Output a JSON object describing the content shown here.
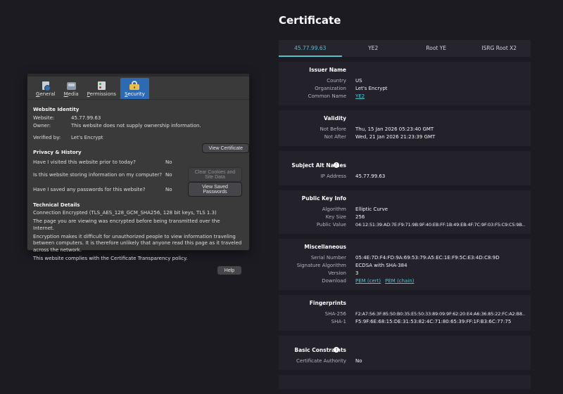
{
  "colors": {
    "page_background": "#1c1b22",
    "accent_teal": "#4ec1cd",
    "selected_tab_blue": "#2d6ab4",
    "padlock_yellow": "#e8c14a",
    "section_background": "#232129"
  },
  "page_info": {
    "tabs": [
      {
        "label": "General"
      },
      {
        "label": "Media"
      },
      {
        "label": "Permissions"
      },
      {
        "label": "Security"
      }
    ],
    "identity": {
      "heading": "Website Identity",
      "website_label": "Website:",
      "website_value": "45.77.99.63",
      "owner_label": "Owner:",
      "owner_value": "This website does not supply ownership information.",
      "verified_label": "Verified by:",
      "verified_value": "Let's Encrypt",
      "view_certificate": "View Certificate"
    },
    "privacy": {
      "heading": "Privacy & History",
      "rows": [
        {
          "question": "Have I visited this website prior to today?",
          "answer": "No"
        },
        {
          "question": "Is this website storing information on my computer?",
          "answer": "No",
          "button": "Clear Cookies and Site Data"
        },
        {
          "question": "Have I saved any passwords for this website?",
          "answer": "No",
          "button": "View Saved Passwords"
        }
      ]
    },
    "technical": {
      "heading": "Technical Details",
      "lines": [
        "Connection Encrypted (TLS_AES_128_GCM_SHA256, 128 bit keys, TLS 1.3)",
        "The page you are viewing was encrypted before being transmitted over the Internet.",
        "Encryption makes it difficult for unauthorized people to view information traveling between computers. It is therefore unlikely that anyone read this page as it traveled across the network.",
        "This website complies with the Certificate Transparency policy."
      ],
      "help": "Help"
    }
  },
  "certificate": {
    "title": "Certificate",
    "critical_icon": "!",
    "tabs": [
      {
        "label": "45.77.99.63"
      },
      {
        "label": "YE2"
      },
      {
        "label": "Root YE"
      },
      {
        "label": "ISRG Root X2"
      }
    ],
    "sections": [
      {
        "heading": "Issuer Name",
        "rows": [
          {
            "label": "Country",
            "value": "US"
          },
          {
            "label": "Organization",
            "value": "Let's Encrypt"
          },
          {
            "label": "Common Name",
            "link": "YE2"
          }
        ]
      },
      {
        "heading": "Validity",
        "rows": [
          {
            "label": "Not Before",
            "value": "Thu, 15 Jan 2026 05:23:40 GMT"
          },
          {
            "label": "Not After",
            "value": "Wed, 21 Jan 2026 21:23:39 GMT"
          }
        ]
      },
      {
        "heading": "Subject Alt Names",
        "rows": [
          {
            "label": "IP Address",
            "value": "45.77.99.63"
          }
        ]
      },
      {
        "heading": "Public Key Info",
        "rows": [
          {
            "label": "Algorithm",
            "value": "Elliptic Curve"
          },
          {
            "label": "Key Size",
            "value": "256"
          },
          {
            "label": "Public Value",
            "value": "04:12:51:39:AD:7E:F9:71:9B:9F:40:EB:FF:1B:49:EB:4F:7C:9F:03:F5:C9:C5:9B…"
          }
        ]
      },
      {
        "heading": "Miscellaneous",
        "rows": [
          {
            "label": "Serial Number",
            "value": "05:4E:7D:F4:FD:9A:69:53:79:A5:EC:1E:F9:5C:E3:4D:C8:9D"
          },
          {
            "label": "Signature Algorithm",
            "value": "ECDSA with SHA-384"
          },
          {
            "label": "Version",
            "value": "3"
          },
          {
            "label": "Download",
            "links": [
              "PEM (cert)",
              "PEM (chain)"
            ]
          }
        ]
      },
      {
        "heading": "Fingerprints",
        "rows": [
          {
            "label": "SHA-256",
            "value": "F2:A7:56:3F:85:50:B0:35:E5:50:33:89:09:9F:62:20:E4:A6:36:85:22:FC:A2:B8…"
          },
          {
            "label": "SHA-1",
            "value": "F5:9F:6E:68:15:DE:31:53:82:4C:71:80:65:39:FF:1F:B3:6C:77:75"
          }
        ]
      },
      {
        "heading": "Basic Constraints",
        "rows": [
          {
            "label": "Certificate Authority",
            "value": "No"
          }
        ]
      }
    ]
  }
}
